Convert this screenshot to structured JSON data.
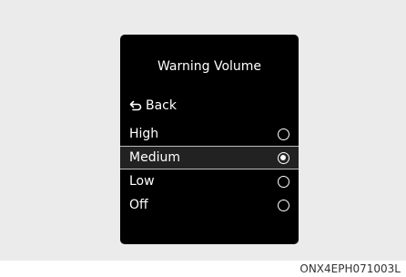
{
  "screen": {
    "title": "Warning Volume",
    "back_label": "Back",
    "options": [
      {
        "label": "High",
        "selected": false
      },
      {
        "label": "Medium",
        "selected": true
      },
      {
        "label": "Low",
        "selected": false
      },
      {
        "label": "Off",
        "selected": false
      }
    ]
  },
  "figure_code": "ONX4EPH071003L"
}
